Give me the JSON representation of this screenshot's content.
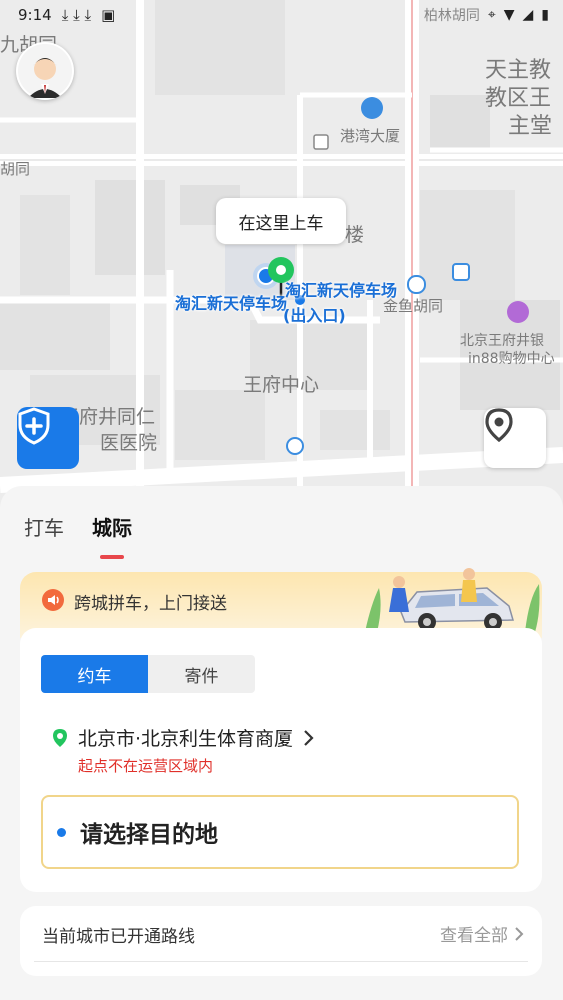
{
  "status_bar": {
    "time": "9:14",
    "carrier_text": "柏林胡同"
  },
  "map": {
    "labels": [
      {
        "text": "九胡同"
      },
      {
        "text": "天主教"
      },
      {
        "text": "教区王"
      },
      {
        "text": "主堂"
      },
      {
        "text": "港湾大厦"
      },
      {
        "text": "胡同"
      },
      {
        "text": "楼"
      },
      {
        "text": "金鱼胡同"
      },
      {
        "text": "北京王府井银"
      },
      {
        "text": "in88购物中心"
      },
      {
        "text": "王府中心"
      },
      {
        "text": "王府井同仁"
      },
      {
        "text": "医医院"
      }
    ],
    "pickup_bubble": "在这里上车",
    "poi_primary": "淘汇新天停车场",
    "poi_secondary": "淘汇新天停车场",
    "poi_entrance": "(出入口)"
  },
  "tabs": [
    {
      "label": "打车",
      "active": false
    },
    {
      "label": "城际",
      "active": true
    }
  ],
  "banner": {
    "text": "跨城拼车，上门接送"
  },
  "booking": {
    "segments": [
      {
        "label": "约车",
        "active": true
      },
      {
        "label": "寄件",
        "active": false
      }
    ],
    "origin": "北京市·北京利生体育商厦",
    "origin_warning": "起点不在运营区域内",
    "destination_placeholder": "请选择目的地"
  },
  "routes": {
    "title": "当前城市已开通路线",
    "view_all": "查看全部"
  },
  "colors": {
    "accent_blue": "#1a7ae8",
    "warning_red": "#e0302a",
    "tab_indicator": "#e8474b",
    "pin_green": "#22c55e"
  }
}
